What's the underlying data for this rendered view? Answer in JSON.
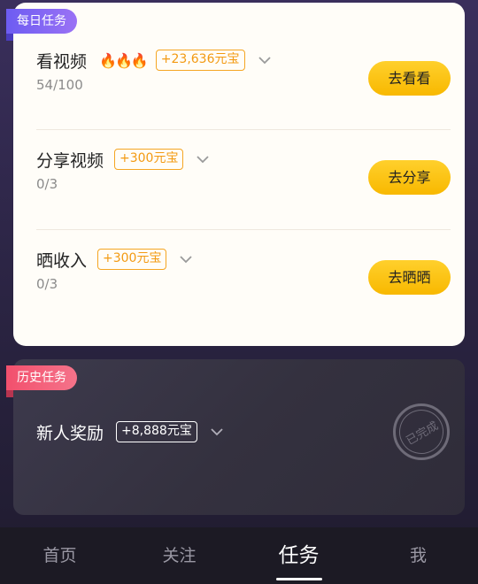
{
  "daily": {
    "tag": "每日任务",
    "tasks": [
      {
        "title": "看视频",
        "fires": "🔥🔥🔥",
        "reward": "+23,636元宝",
        "progress": "54/100",
        "action": "去看看"
      },
      {
        "title": "分享视频",
        "reward": "+300元宝",
        "progress": "0/3",
        "action": "去分享"
      },
      {
        "title": "晒收入",
        "reward": "+300元宝",
        "progress": "0/3",
        "action": "去晒晒"
      }
    ]
  },
  "history": {
    "tag": "历史任务",
    "tasks": [
      {
        "title": "新人奖励",
        "reward": "+8,888元宝",
        "stamp": "已完成"
      }
    ]
  },
  "nav": {
    "items": [
      "首页",
      "关注",
      "任务",
      "我"
    ],
    "active": "任务"
  },
  "colors": {
    "accent": "#f8b800",
    "reward": "#f39a12",
    "daily_tag": "#7b63f3",
    "history_tag": "#f2506d"
  }
}
